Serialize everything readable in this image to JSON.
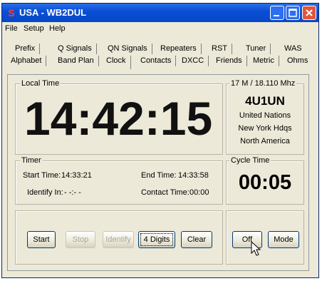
{
  "window": {
    "title": "USA - WB2DUL",
    "app_icon": "ham-radio-app-icon"
  },
  "menu": [
    "File",
    "Setup",
    "Help"
  ],
  "tabs_row1": [
    "Prefix",
    "Q Signals",
    "QN Signals",
    "Repeaters",
    "RST",
    "Tuner",
    "WAS"
  ],
  "tabs_row2": [
    "Alphabet",
    "Band Plan",
    "Clock",
    "Contacts",
    "DXCC",
    "Friends",
    "Metric",
    "Ohms"
  ],
  "active_tab": "Clock",
  "local_time": {
    "label": "Local Time",
    "value": "14:42:15"
  },
  "frequency": {
    "label": "17 M / 18.110 Mhz",
    "callsign": "4U1UN",
    "line1": "United Nations",
    "line2": "New York Hdqs",
    "line3": "North America"
  },
  "timer": {
    "label": "Timer",
    "start_label": "Start Time:",
    "start_value": "14:33:21",
    "end_label": "End Time:",
    "end_value": "14:33:58",
    "identify_label": "Identify In:",
    "identify_value": "- -:- -",
    "contact_label": "Contact Time:",
    "contact_value": "00:00"
  },
  "cycle": {
    "label": "Cycle Time",
    "value": "00:05"
  },
  "buttons": {
    "start": "Start",
    "stop": "Stop",
    "identify": "Identify",
    "digits": "4 Digits",
    "clear": "Clear",
    "off": "Off",
    "mode": "Mode"
  }
}
